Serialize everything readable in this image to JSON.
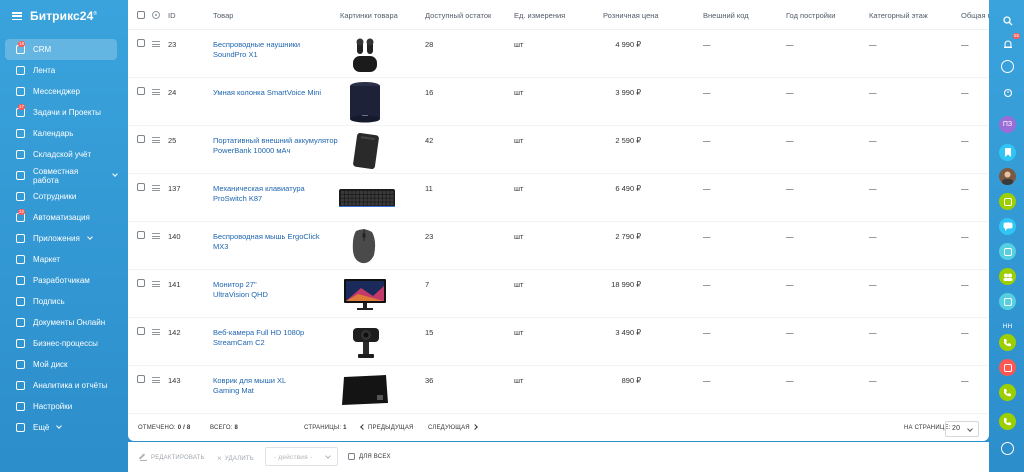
{
  "app": {
    "logo": "Битрикс24",
    "logo_mark": "®"
  },
  "sidebar": {
    "items": [
      {
        "label": "CRM",
        "icon": "crm-icon",
        "badge": "18",
        "active": true
      },
      {
        "label": "Лента",
        "icon": "feed-icon"
      },
      {
        "label": "Мессенджер",
        "icon": "messenger-icon"
      },
      {
        "label": "Задачи и Проекты",
        "icon": "tasks-icon",
        "badge": "17"
      },
      {
        "label": "Календарь",
        "icon": "calendar-icon"
      },
      {
        "label": "Складской учёт",
        "icon": "warehouse-icon"
      },
      {
        "label": "Совместная работа",
        "icon": "collaboration-icon",
        "chevron": true
      },
      {
        "label": "Сотрудники",
        "icon": "employees-icon"
      },
      {
        "label": "Автоматизация",
        "icon": "automation-icon",
        "badge": "22"
      },
      {
        "label": "Приложения",
        "icon": "apps-icon",
        "chevron": true
      },
      {
        "label": "Маркет",
        "icon": "market-icon"
      },
      {
        "label": "Разработчикам",
        "icon": "developers-icon"
      },
      {
        "label": "Подпись",
        "icon": "signature-icon"
      },
      {
        "label": "Документы Онлайн",
        "icon": "documents-icon"
      },
      {
        "label": "Бизнес-процессы",
        "icon": "business-processes-icon"
      },
      {
        "label": "Мой диск",
        "icon": "disk-icon"
      },
      {
        "label": "Аналитика и отчёты",
        "icon": "analytics-icon"
      },
      {
        "label": "Настройки",
        "icon": "settings-icon"
      },
      {
        "label": "Ещё",
        "icon": "more-icon",
        "chevron": true
      }
    ]
  },
  "grid": {
    "columns": {
      "id": "ID",
      "product": "Товар",
      "images": "Картинки товара",
      "stock": "Доступный остаток",
      "unit": "Ед. измерения",
      "price": "Розничная цена",
      "external_code": "Внешний код",
      "year": "Год постройки",
      "floor": "Категорный этаж",
      "total": "Общая п"
    },
    "rows": [
      {
        "id": "23",
        "name": "Беспроводные наушники SoundPro X1",
        "image": "earbuds-image",
        "stock": "28",
        "unit": "шт",
        "price": "4 990 ₽",
        "ext": "—",
        "year": "—",
        "floor": "—",
        "total": "—"
      },
      {
        "id": "24",
        "name": "Умная колонка SmartVoice Mini",
        "image": "smart-speaker-image",
        "stock": "16",
        "unit": "шт",
        "price": "3 990 ₽",
        "ext": "—",
        "year": "—",
        "floor": "—",
        "total": "—"
      },
      {
        "id": "25",
        "name": "Портативный внешний аккумулятор PowerBank 10000 мАч",
        "image": "powerbank-image",
        "stock": "42",
        "unit": "шт",
        "price": "2 590 ₽",
        "ext": "—",
        "year": "—",
        "floor": "—",
        "total": "—"
      },
      {
        "id": "137",
        "name": "Механическая клавиатура ProSwitch K87",
        "image": "keyboard-image",
        "stock": "11",
        "unit": "шт",
        "price": "6 490 ₽",
        "ext": "—",
        "year": "—",
        "floor": "—",
        "total": "—"
      },
      {
        "id": "140",
        "name": "Беспроводная мышь ErgoClick MX3",
        "image": "mouse-image",
        "stock": "23",
        "unit": "шт",
        "price": "2 790 ₽",
        "ext": "—",
        "year": "—",
        "floor": "—",
        "total": "—"
      },
      {
        "id": "141",
        "name": "Монитор 27\" UltraVision QHD",
        "image": "monitor-image",
        "stock": "7",
        "unit": "шт",
        "price": "18 990 ₽",
        "ext": "—",
        "year": "—",
        "floor": "—",
        "total": "—"
      },
      {
        "id": "142",
        "name": "Веб-камера Full HD 1080p StreamCam C2",
        "image": "webcam-image",
        "stock": "15",
        "unit": "шт",
        "price": "3 490 ₽",
        "ext": "—",
        "year": "—",
        "floor": "—",
        "total": "—"
      },
      {
        "id": "143",
        "name": "Коврик для мыши XL Gaming Mat",
        "image": "mousepad-image",
        "stock": "36",
        "unit": "шт",
        "price": "890 ₽",
        "ext": "—",
        "year": "—",
        "floor": "—",
        "total": "—"
      }
    ]
  },
  "footer": {
    "selected_label": "Отмечено:",
    "selected_value": "0 / 8",
    "total_label": "Всего:",
    "total_value": "8",
    "pages_label": "Страницы:",
    "pages_value": "1",
    "prev_label": "Предыдущая",
    "next_label": "Следующая",
    "per_page_label": "На странице:",
    "per_page_value": "20"
  },
  "actions": {
    "edit_label": "Редактировать",
    "delete_label": "Удалить",
    "actions_select": "- действия -",
    "for_all_label": "Для всех"
  },
  "rightbar": {
    "notifications_badge": "55",
    "avatar_initials": "ПЗ",
    "user_initials": "НН"
  },
  "colors": {
    "sidebar_bg": "#2c8ecb",
    "link": "#2066b0",
    "badge": "#ff5752"
  }
}
